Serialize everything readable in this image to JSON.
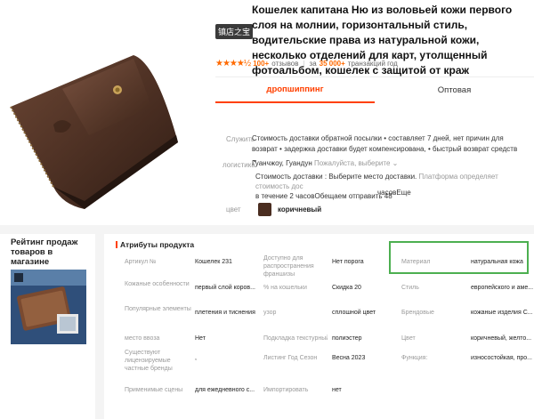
{
  "product": {
    "shop_badge": "镇店之宝",
    "title": "Кошелек капитана Ню из воловьей кожи первого слоя на молнии, горизонтальный стиль, водительские права из натуральной кожи, несколько отделений для карт, утолщенный фотоальбом, кошелек с защитой от краж",
    "stars": "★★★★½",
    "reviews_count": "100+",
    "reviews_label": "отзывов",
    "transactions_count": "35 000+",
    "transactions_label": "транзакций год"
  },
  "tabs": [
    {
      "label": "дропшиппинг",
      "active": true
    },
    {
      "label": "Оптовая",
      "active": false
    }
  ],
  "shipping": {
    "label": "Служить",
    "text": "Стоимость доставки обратной посылки • составляет 7 дней, нет причин для возврат • задержка доставки будет компенсирована, • быстрый возврат средств ⌄"
  },
  "logistics": {
    "label": "логистика",
    "from": "Гуанчжоу, Гуандун",
    "hint": "Пожалуйста, выберите ⌄",
    "cost_text": "Стоимость доставки : Выберите место доставки.",
    "cost_hint": "Платформа определяет стоимость дос",
    "time_text": "в течение 2 часовОбещаем отправить 48",
    "time_suffix": "часовЕще"
  },
  "color": {
    "label": "цвет",
    "name": "коричневый",
    "swatch": "#4a2d20"
  },
  "sidebar": {
    "title": "Рейтинг продаж товаров в магазине"
  },
  "attributes": {
    "heading": "Атрибуты продукта",
    "accent": "#ff4000",
    "highlight_color": "#4caf50",
    "rows": [
      [
        "Артикул №",
        "Кошелек 231",
        "Доступно для распространения франшизы",
        "Нет порога",
        "Материал",
        "натуральная кожа"
      ],
      [
        "Кожаные особенности",
        "первый слой коров...",
        "% на кошельки",
        "Скидка 20",
        "Стиль",
        "европейского и аме..."
      ],
      [
        "Популярные элементы",
        "плетения и тиснения",
        "узор",
        "сплошной цвет",
        "Брендовые",
        "кожаные изделия С..."
      ],
      [
        "место ввоза",
        "Нет",
        "Подкладка текстурный",
        "полиэстер",
        "Цвет",
        "коричневый, желто..."
      ],
      [
        "Существуют лицензируемые частные бренды",
        ",",
        "Листинг Год Сезон",
        "Весна 2023",
        "Функция:",
        "износостойкая, про..."
      ],
      [
        "Применимые сцены",
        "для ежедневного с...",
        "Импортировать",
        "нет",
        "",
        ""
      ]
    ]
  }
}
